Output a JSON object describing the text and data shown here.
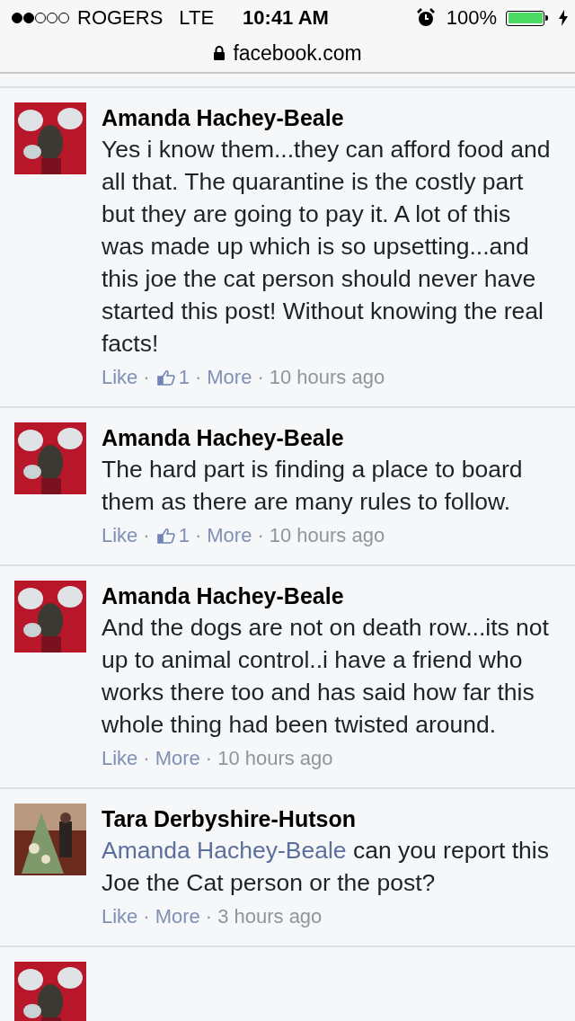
{
  "status_bar": {
    "carrier": "ROGERS",
    "network": "LTE",
    "time": "10:41 AM",
    "battery_percent": "100%",
    "battery": {
      "level": 1
    }
  },
  "address_bar": {
    "url": "facebook.com"
  },
  "comments": [
    {
      "avatar": {
        "kind": "picture"
      },
      "author": "Amanda Hachey-Beale",
      "text": "Yes i know them...they can afford food and all that. The quarantine is the costly part but they are going to pay it. A lot of this was made up which is so upsetting...and this joe the cat person should never have started this post! Without knowing the real facts!",
      "like": "Like",
      "like_count": "1",
      "more": "More",
      "separator": "·",
      "time": "10 hours ago"
    },
    {
      "avatar": {
        "kind": "picture"
      },
      "author": "Amanda Hachey-Beale",
      "text": "The hard part is finding a place to board them as there are many rules to follow.",
      "like": "Like",
      "like_count": "1",
      "more": "More",
      "separator": "·",
      "time": "10 hours ago"
    },
    {
      "avatar": {
        "kind": "picture"
      },
      "author": "Amanda Hachey-Beale",
      "text": "And the dogs are not on death row...its not up to animal control..i have a friend who works there too and has said how far this whole thing had been twisted around.",
      "like": "Like",
      "more": "More",
      "separator": "·",
      "time": "10 hours ago"
    },
    {
      "avatar": {
        "kind": "picture"
      },
      "author": "Tara Derbyshire-Hutson",
      "mention": "Amanda Hachey-Beale",
      "text": "can you report this Joe the Cat person or the post?",
      "like": "Like",
      "more": "More",
      "separator": "·",
      "time": "3 hours ago"
    },
    {
      "avatar": {
        "kind": "picture"
      }
    }
  ]
}
